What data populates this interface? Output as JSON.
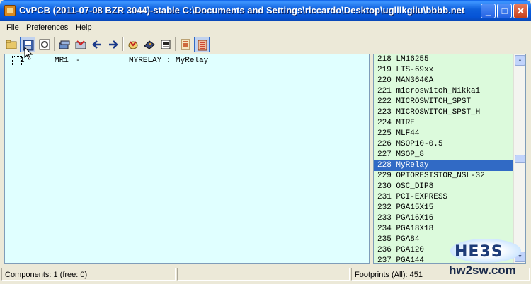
{
  "window": {
    "title": "CvPCB (2011-07-08 BZR 3044)-stable C:\\Documents and Settings\\riccardo\\Desktop\\uglilkgilu\\bbbb.net",
    "minimize_label": "_",
    "maximize_label": "□",
    "close_label": "✕"
  },
  "menu": [
    "File",
    "Preferences",
    "Help"
  ],
  "toolbar": {
    "icons": [
      "open-icon",
      "save-icon",
      "config-icon",
      "library-icon",
      "auto-assoc-icon",
      "prev-icon",
      "next-icon",
      "auto-select-icon",
      "view-footprint-icon",
      "delete-assoc-icon",
      "create-bom-icon",
      "filter-keyword-icon",
      "filter-pins-icon"
    ]
  },
  "components": [
    {
      "index": "1",
      "reference": "MR1",
      "separator": "-",
      "value": "MYRELAY : MyRelay"
    }
  ],
  "footprints": [
    {
      "num": "218",
      "name": "LM16255"
    },
    {
      "num": "219",
      "name": "LTS-69xx"
    },
    {
      "num": "220",
      "name": "MAN3640A"
    },
    {
      "num": "221",
      "name": "microswitch_Nikkai"
    },
    {
      "num": "222",
      "name": "MICROSWITCH_SPST"
    },
    {
      "num": "223",
      "name": "MICROSWITCH_SPST_H"
    },
    {
      "num": "224",
      "name": "MIRE"
    },
    {
      "num": "225",
      "name": "MLF44"
    },
    {
      "num": "226",
      "name": "MSOP10-0.5"
    },
    {
      "num": "227",
      "name": "MSOP_8"
    },
    {
      "num": "228",
      "name": "MyRelay",
      "selected": true
    },
    {
      "num": "229",
      "name": "OPTORESISTOR_NSL-32"
    },
    {
      "num": "230",
      "name": "OSC_DIP8"
    },
    {
      "num": "231",
      "name": "PCI-EXPRESS"
    },
    {
      "num": "232",
      "name": "PGA15X15"
    },
    {
      "num": "233",
      "name": "PGA16X16"
    },
    {
      "num": "234",
      "name": "PGA18X18"
    },
    {
      "num": "235",
      "name": "PGA84"
    },
    {
      "num": "236",
      "name": "PGA120"
    },
    {
      "num": "237",
      "name": "PGA144"
    }
  ],
  "status": {
    "components": "Components: 1 (free: 0)",
    "middle": "",
    "footprints": "Footprints (All): 451"
  },
  "watermark": {
    "logo": "HE3S",
    "url": "hw2sw.com"
  },
  "colors": {
    "left_panel_bg": "#e0ffff",
    "right_panel_bg": "#dcfadc",
    "selection": "#316ac5"
  }
}
